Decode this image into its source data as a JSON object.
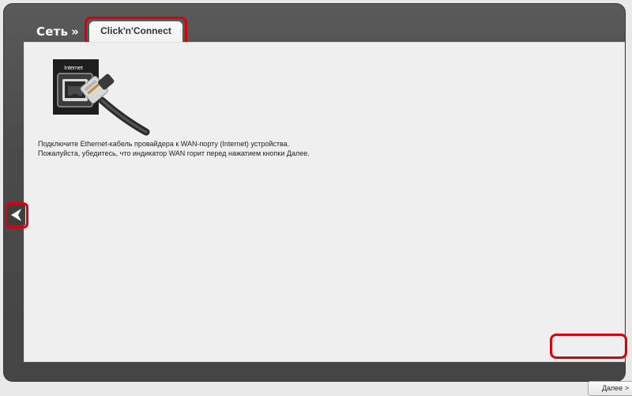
{
  "header": {
    "breadcrumb": "Сеть",
    "breadcrumb_separator": "»",
    "active_tab": "Click'n'Connect"
  },
  "wan_image": {
    "port_label": "Internet",
    "icon": "ethernet-cable-icon"
  },
  "instructions": {
    "line1": "Подключите Ethernet-кабель провайдера к WAN-порту (Internet) устройства.",
    "line2": "Пожалуйста, убедитесь, что индикатор WAN горит перед нажатием кнопки Далее."
  },
  "navigation": {
    "back_icon": "back-arrow-icon",
    "next_label": "Далее >"
  },
  "colors": {
    "frame": "#4a4a4a",
    "content_bg": "#efefef",
    "highlight": "#d8000a"
  }
}
